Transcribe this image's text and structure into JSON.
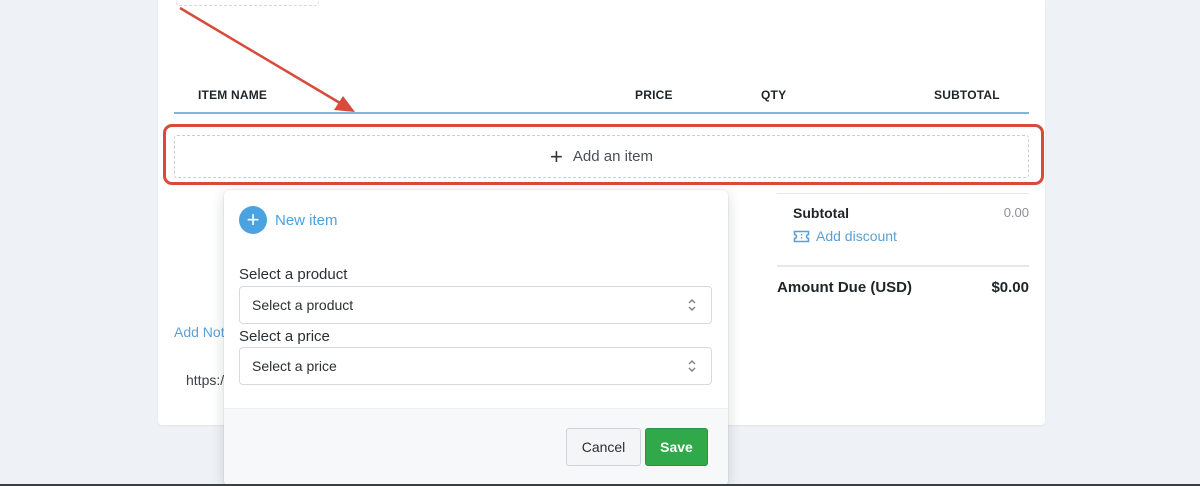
{
  "table": {
    "headers": {
      "item_name": "ITEM NAME",
      "price": "PRICE",
      "qty": "QTY",
      "subtotal": "SUBTOTAL"
    },
    "add_item_label": "Add an item"
  },
  "totals": {
    "subtotal_label": "Subtotal",
    "subtotal_value": "0.00",
    "add_discount_label": "Add discount",
    "amount_due_label": "Amount Due (USD)",
    "amount_due_value": "$0.00"
  },
  "notes": {
    "add_notes_label": "Add Not",
    "url_fragment": "https:/"
  },
  "popover": {
    "title": "New item",
    "product_label": "Select a product",
    "product_select_value": "Select a product",
    "price_label": "Select a price",
    "price_select_value": "Select a price",
    "cancel_label": "Cancel",
    "save_label": "Save"
  },
  "colors": {
    "highlight": "#d94a3a",
    "link": "#5aa0d6",
    "primary": "#4aa3e0",
    "save": "#2fa94a"
  },
  "icons": {
    "add_item": "plus-icon",
    "new_item": "plus-circle-icon",
    "discount": "ticket-icon",
    "select": "updown-chevron-icon"
  }
}
